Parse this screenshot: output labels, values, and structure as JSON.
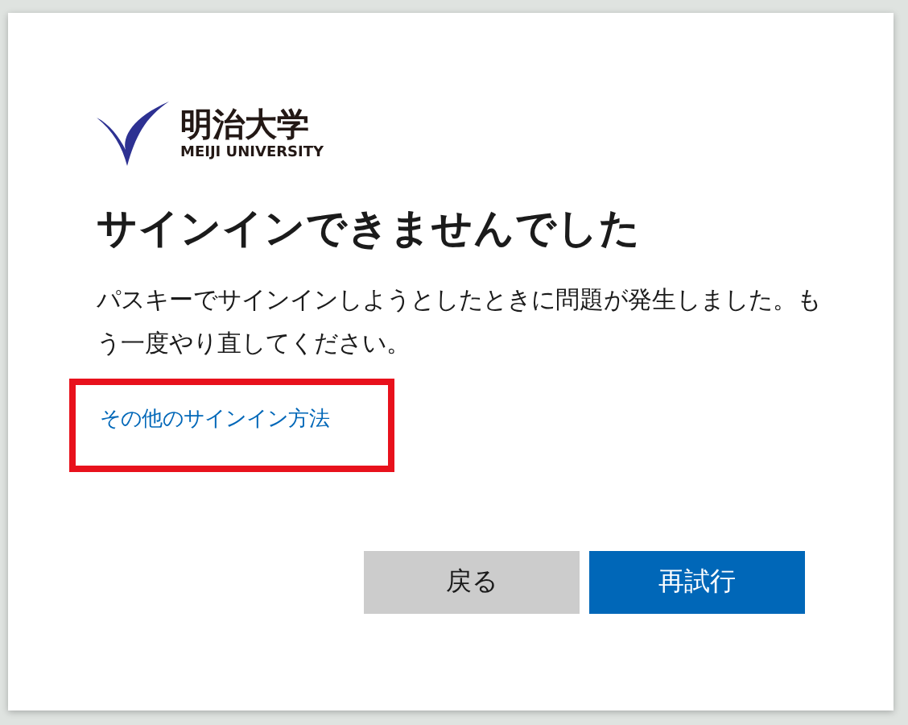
{
  "logo": {
    "name": "明治大学",
    "name_en": "MEIJI UNIVERSITY"
  },
  "heading": "サインインできませんでした",
  "message": "パスキーでサインインしようとしたときに問題が発生しました。もう一度やり直してください。",
  "link": {
    "text": "その他のサインイン方法",
    "highlighted": true
  },
  "buttons": [
    {
      "label": "戻る",
      "kind": "secondary"
    },
    {
      "label": "再試行",
      "kind": "primary"
    }
  ]
}
